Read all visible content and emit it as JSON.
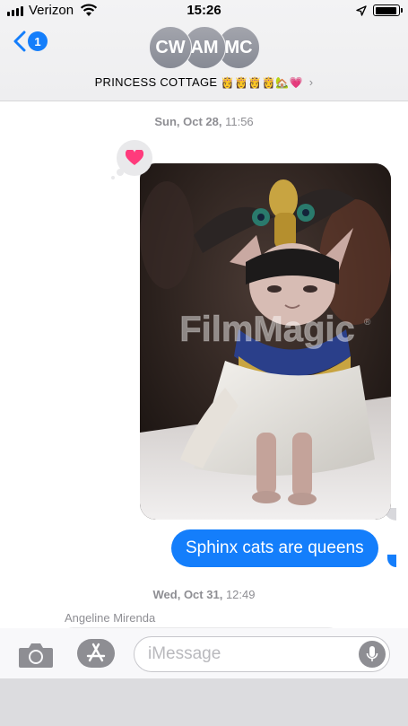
{
  "status_bar": {
    "carrier": "Verizon",
    "time": "15:26",
    "battery_level": 0.95
  },
  "nav": {
    "back_count": "1",
    "participants": [
      "CW",
      "AM",
      "MC"
    ],
    "group_name": "PRINCESS COTTAGE",
    "group_emojis": "👸👸👸👸🏡💗",
    "chevron": "›"
  },
  "conversation": {
    "date1": {
      "day": "Sun, Oct 28,",
      "time": "11:56"
    },
    "tapback_icon": "heart-icon",
    "photo": {
      "description": "sphynx-cat-in-cleopatra-costume",
      "watermark": "FilmMagic",
      "trademark": "®"
    },
    "outgoing_message": "Sphinx cats are queens",
    "date2": {
      "day": "Wed, Oct 31,",
      "time": "12:49"
    },
    "sender": "Angeline Mirenda"
  },
  "input_bar": {
    "placeholder": "iMessage",
    "value": ""
  },
  "colors": {
    "accent": "#147efb",
    "heart": "#ff3b7c",
    "avatar": "#9a9ca4"
  }
}
